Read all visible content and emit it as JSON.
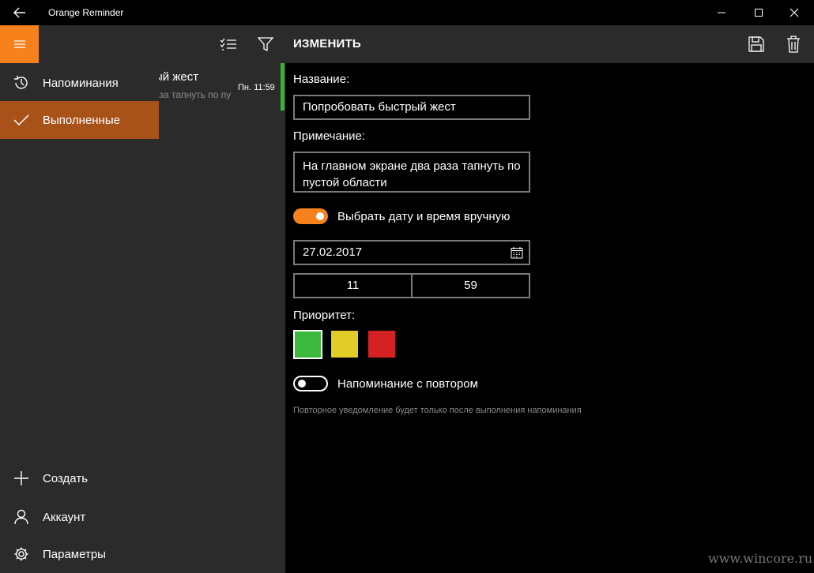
{
  "window": {
    "title": "Orange Reminder",
    "back_icon": "back-arrow-icon",
    "minimize_icon": "minimize-icon",
    "maximize_icon": "maximize-icon",
    "close_icon": "close-icon"
  },
  "header": {
    "title": "ИЗМЕНИТЬ",
    "icons": [
      "hamburger-icon",
      "select-list-icon",
      "filter-icon",
      "save-icon",
      "delete-icon"
    ]
  },
  "nav": {
    "items": [
      {
        "label": "Напоминания",
        "icon": "history-icon"
      },
      {
        "label": "Выполненные",
        "icon": "checkmark-icon",
        "active": true
      }
    ],
    "bottom_items": [
      {
        "label": "Создать",
        "icon": "add-icon"
      },
      {
        "label": "Аккаунт",
        "icon": "person-icon"
      },
      {
        "label": "Параметры",
        "icon": "settings-icon"
      }
    ]
  },
  "list": {
    "items": [
      {
        "title": "ый жест",
        "subtitle": "аза тапнуть по пу",
        "time": "Пн. 11:59",
        "priority_color": "#35b535"
      }
    ]
  },
  "form": {
    "name_label": "Название:",
    "name_value": "Попробовать быстрый жест",
    "note_label": "Примечание:",
    "note_value": "На главном экране два раза тапнуть по пустой области",
    "manual_toggle_label": "Выбрать дату и время вручную",
    "manual_toggle_on": true,
    "date_value": "27.02.2017",
    "calendar_icon": "calendar-icon",
    "hour_value": "11",
    "minute_value": "59",
    "priority_label": "Приоритет:",
    "priority_colors": [
      "#3cb93c",
      "#e2cc28",
      "#d42222"
    ],
    "priority_selected": 0,
    "repeat_toggle_label": "Напоминание с повтором",
    "repeat_toggle_on": false,
    "repeat_hint": "Повторное уведомление будет только после выполнения напоминания"
  },
  "colors": {
    "accent": "#f7821b",
    "nav_active": "#a8521a",
    "pane_bg": "#2b2b2b"
  },
  "watermark": "www.wincore.ru"
}
